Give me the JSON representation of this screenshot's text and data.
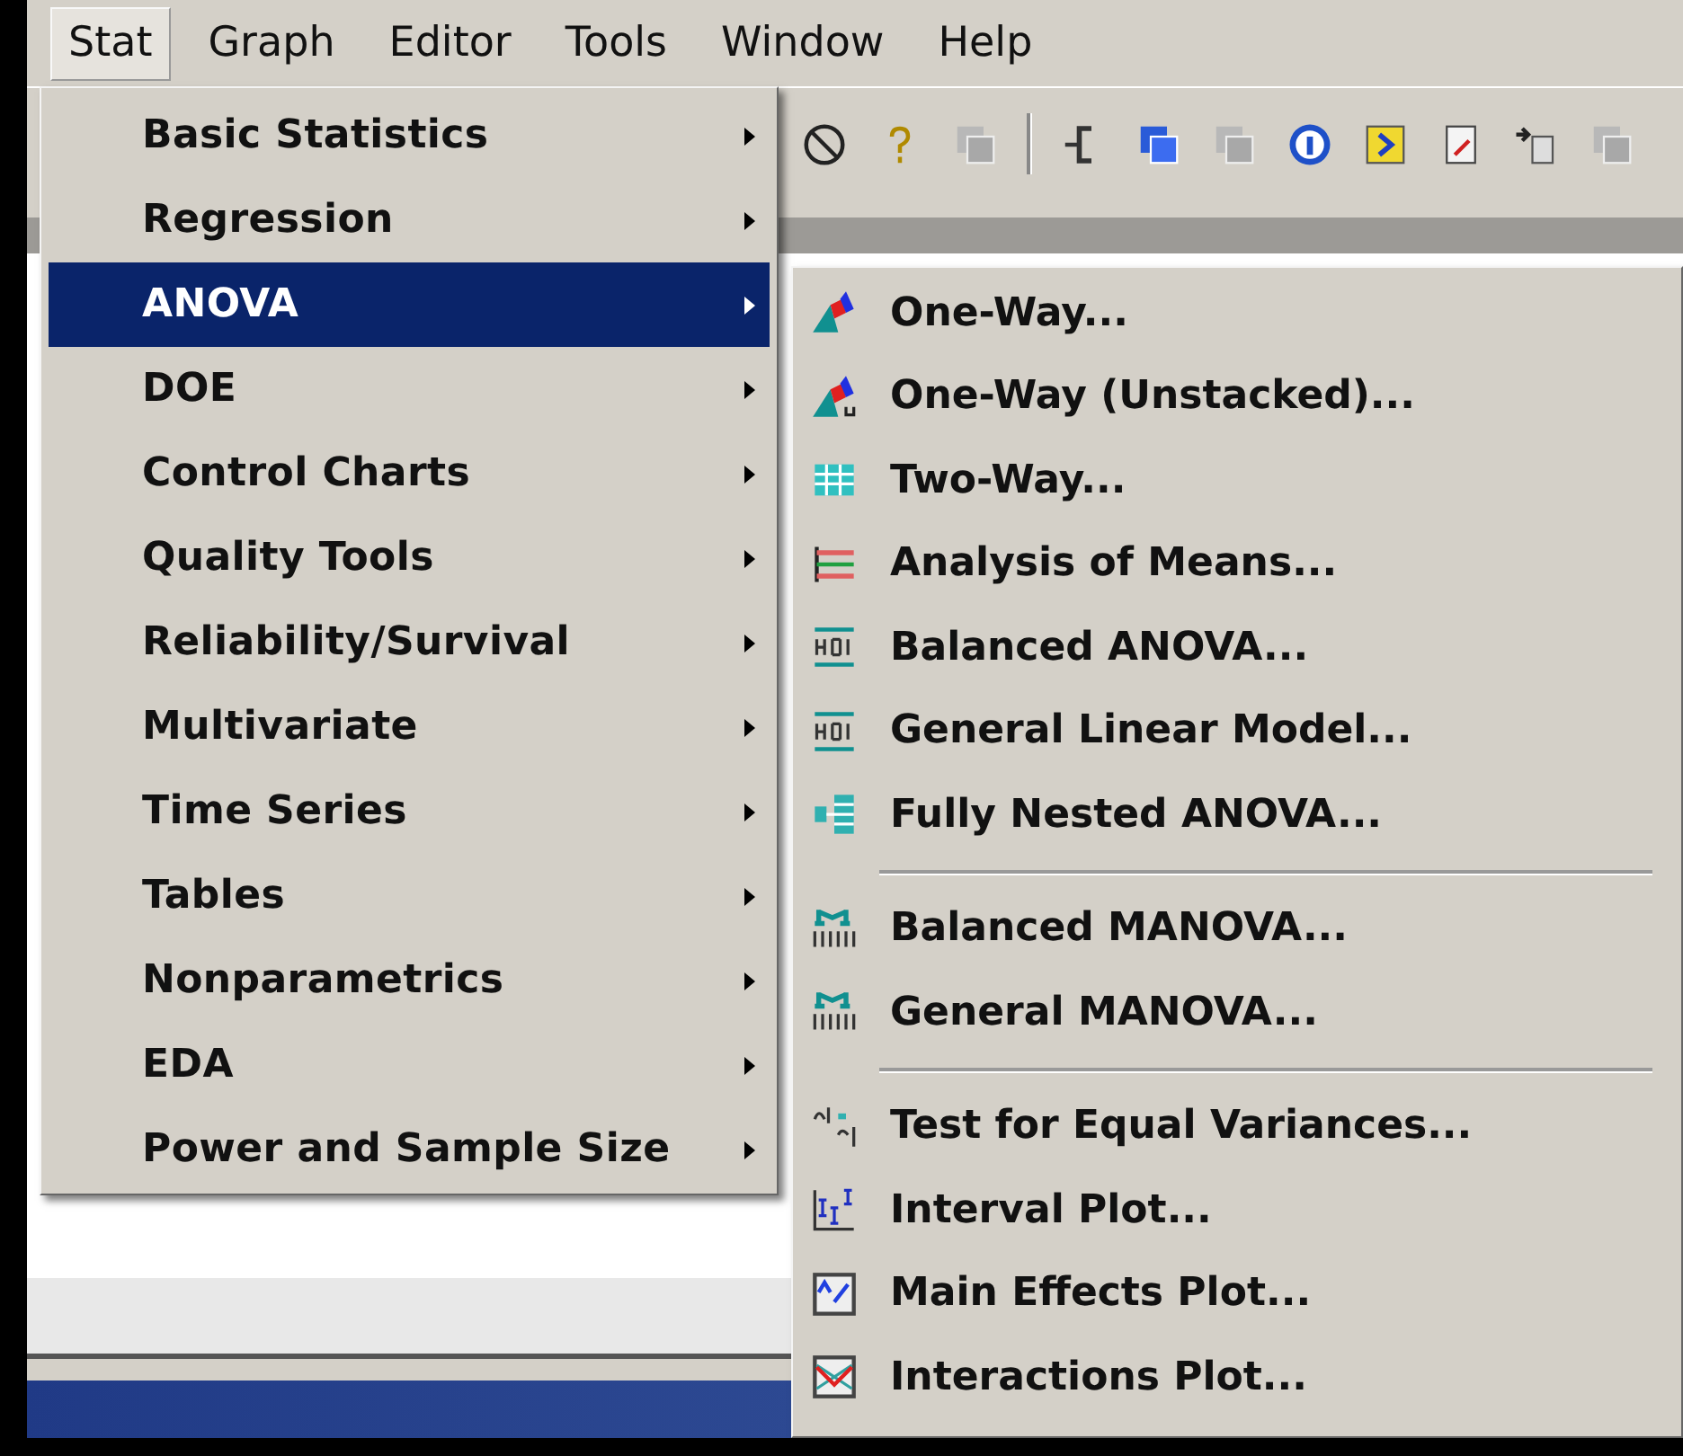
{
  "menu_bar": [
    {
      "label": "Stat",
      "selected": true
    },
    {
      "label": "Graph",
      "selected": false
    },
    {
      "label": "Editor",
      "selected": false
    },
    {
      "label": "Tools",
      "selected": false
    },
    {
      "label": "Window",
      "selected": false
    },
    {
      "label": "Help",
      "selected": false
    }
  ],
  "stat_menu": [
    {
      "label": "Basic Statistics",
      "selected": false
    },
    {
      "label": "Regression",
      "selected": false
    },
    {
      "label": "ANOVA",
      "selected": true
    },
    {
      "label": "DOE",
      "selected": false
    },
    {
      "label": "Control Charts",
      "selected": false
    },
    {
      "label": "Quality Tools",
      "selected": false
    },
    {
      "label": "Reliability/Survival",
      "selected": false
    },
    {
      "label": "Multivariate",
      "selected": false
    },
    {
      "label": "Time Series",
      "selected": false
    },
    {
      "label": "Tables",
      "selected": false
    },
    {
      "label": "Nonparametrics",
      "selected": false
    },
    {
      "label": "EDA",
      "selected": false
    },
    {
      "label": "Power and Sample Size",
      "selected": false
    }
  ],
  "anova_submenu": {
    "groups": [
      {
        "items": [
          "One-Way...",
          "One-Way (Unstacked)...",
          "Two-Way...",
          "Analysis of Means...",
          "Balanced ANOVA...",
          "General Linear Model...",
          "Fully Nested ANOVA..."
        ]
      },
      {
        "items": [
          "Balanced MANOVA...",
          "General MANOVA..."
        ]
      },
      {
        "items": [
          "Test for Equal Variances...",
          "Interval Plot...",
          "Main Effects Plot...",
          "Interactions Plot..."
        ]
      }
    ]
  }
}
